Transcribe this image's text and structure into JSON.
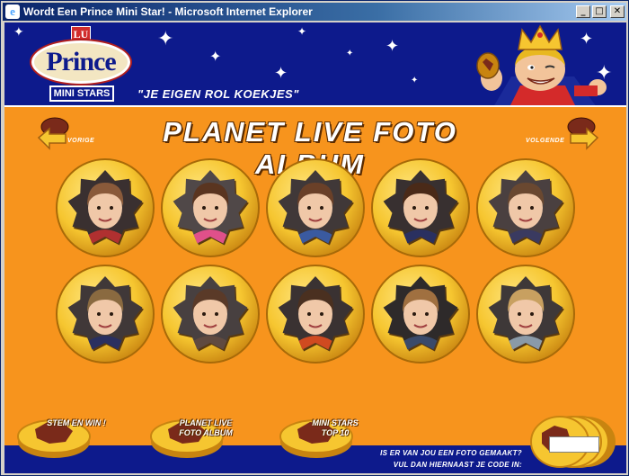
{
  "window": {
    "title": "Wordt Een Prince Mini Star! - Microsoft Internet Explorer",
    "minimize": "_",
    "maximize": "□",
    "close": "✕"
  },
  "header": {
    "logo_lu": "LU",
    "logo_brand": "Prince",
    "logo_sub": "MINI STARS",
    "tagline": "\"JE EIGEN ROL KOEKJES\""
  },
  "page": {
    "title": "PLANET LIVE FOTO ALBUM",
    "prev_label": "VORIGE",
    "next_label": "VOLGENDE"
  },
  "photos": [
    {
      "id": "photo-1",
      "hair": "#8a5a3a",
      "shirt": "#b03030",
      "bg": "#3a3030"
    },
    {
      "id": "photo-2",
      "hair": "#5a3520",
      "shirt": "#e0508a",
      "bg": "#504848"
    },
    {
      "id": "photo-3",
      "hair": "#6a4028",
      "shirt": "#3a5aa0",
      "bg": "#403838"
    },
    {
      "id": "photo-4",
      "hair": "#4a2a18",
      "shirt": "#2a3060",
      "bg": "#383030"
    },
    {
      "id": "photo-5",
      "hair": "#6a4830",
      "shirt": "#3a3a60",
      "bg": "#4a4040"
    },
    {
      "id": "photo-6",
      "hair": "#8a6a40",
      "shirt": "#2a3060",
      "bg": "#403838"
    },
    {
      "id": "photo-7",
      "hair": "#5a3a28",
      "shirt": "#604a40",
      "bg": "#484040"
    },
    {
      "id": "photo-8",
      "hair": "#4a3020",
      "shirt": "#d04a20",
      "bg": "#3a3232"
    },
    {
      "id": "photo-9",
      "hair": "#a07040",
      "shirt": "#3a4a6a",
      "bg": "#2e2a2a"
    },
    {
      "id": "photo-10",
      "hair": "#c8a060",
      "shirt": "#8a9aa8",
      "bg": "#3e3838"
    }
  ],
  "bottom": {
    "stem_label": "STEM EN WIN !",
    "album_label_1": "PLANET LIVE",
    "album_label_2": "FOTO ALBUM",
    "top_label_1": "MINI STARS",
    "top_label_2": "TOP 10",
    "code_q1": "IS ER VAN JOU EEN FOTO GEMAAKT?",
    "code_q2": "VUL DAN HIERNAAST JE CODE IN:",
    "code_value": ""
  },
  "colors": {
    "orange": "#f7941d",
    "navy": "#0d1a8c",
    "gold": "#f6c630",
    "gold_dark": "#c88410",
    "chocolate": "#7a2a1a"
  }
}
